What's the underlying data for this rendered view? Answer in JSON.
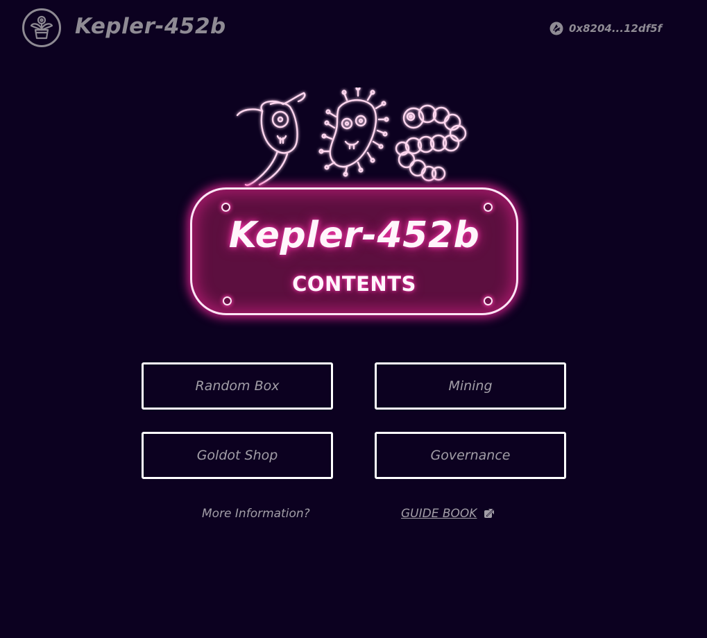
{
  "header": {
    "title": "Kepler-452b",
    "logo_icon": "plant-pot-icon",
    "wallet_icon": "wallet-network-icon",
    "wallet_address": "0x8204...12df5f"
  },
  "hero": {
    "illustration_icon": "neon-microbes-icon",
    "sign_title": "Kepler-452b",
    "sign_subtitle": "CONTENTS"
  },
  "menu": {
    "items": [
      {
        "label": "Random Box"
      },
      {
        "label": "Mining"
      },
      {
        "label": "Goldot Shop"
      },
      {
        "label": "Governance"
      }
    ]
  },
  "footer": {
    "prompt": "More Information?",
    "guide_label": "GUIDE BOOK",
    "guide_icon": "external-link-icon"
  },
  "colors": {
    "background": "#0c0120",
    "muted_text": "#a29ea7",
    "neon_pink": "#ff28a0",
    "sign_fill": "#5c0f3f",
    "button_border": "#ffffff"
  }
}
